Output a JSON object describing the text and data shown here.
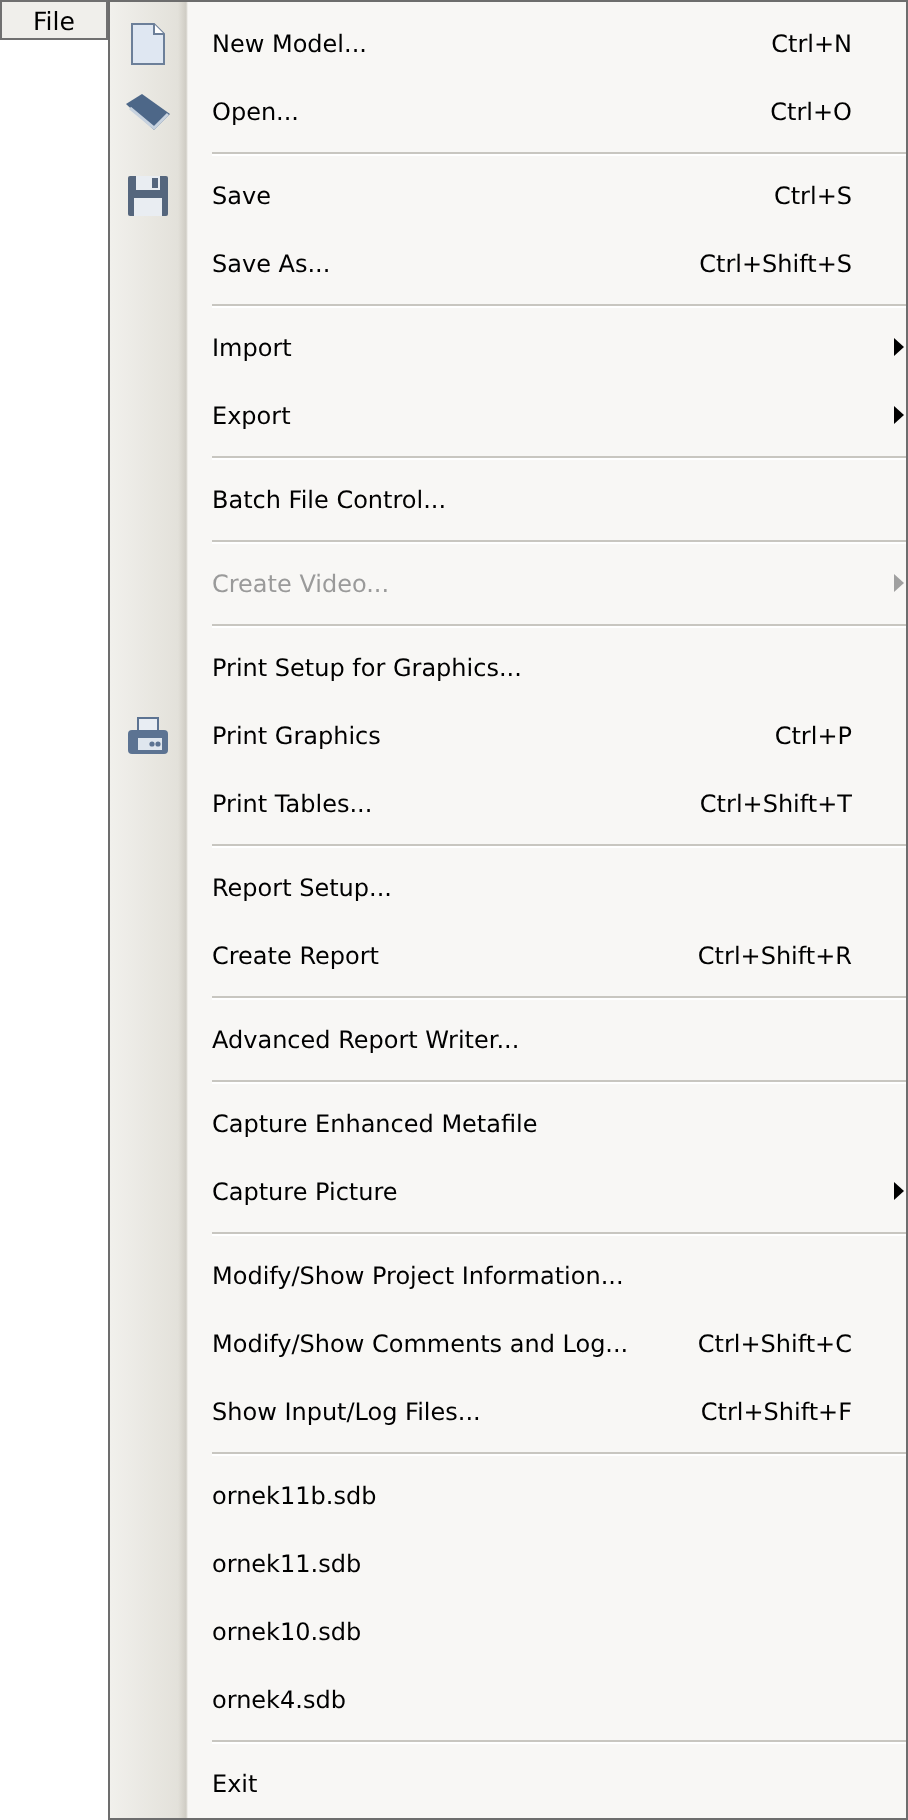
{
  "file_button": {
    "label": "File"
  },
  "menu": {
    "items": [
      {
        "kind": "item",
        "label": "New Model...",
        "shortcut": "Ctrl+N",
        "submenu": false,
        "disabled": false
      },
      {
        "kind": "item",
        "label": "Open...",
        "shortcut": "Ctrl+O",
        "submenu": false,
        "disabled": false
      },
      {
        "kind": "separator"
      },
      {
        "kind": "item",
        "label": "Save",
        "shortcut": "Ctrl+S",
        "submenu": false,
        "disabled": false
      },
      {
        "kind": "item",
        "label": "Save As...",
        "shortcut": "Ctrl+Shift+S",
        "submenu": false,
        "disabled": false
      },
      {
        "kind": "separator"
      },
      {
        "kind": "item",
        "label": "Import",
        "submenu": true,
        "disabled": false
      },
      {
        "kind": "item",
        "label": "Export",
        "submenu": true,
        "disabled": false
      },
      {
        "kind": "separator"
      },
      {
        "kind": "item",
        "label": "Batch File Control...",
        "submenu": false,
        "disabled": false
      },
      {
        "kind": "separator"
      },
      {
        "kind": "item",
        "label": "Create Video...",
        "submenu": true,
        "disabled": true
      },
      {
        "kind": "separator"
      },
      {
        "kind": "item",
        "label": "Print Setup for Graphics...",
        "submenu": false,
        "disabled": false
      },
      {
        "kind": "item",
        "label": "Print Graphics",
        "shortcut": "Ctrl+P",
        "submenu": false,
        "disabled": false
      },
      {
        "kind": "item",
        "label": "Print Tables...",
        "shortcut": "Ctrl+Shift+T",
        "submenu": false,
        "disabled": false
      },
      {
        "kind": "separator"
      },
      {
        "kind": "item",
        "label": "Report Setup...",
        "submenu": false,
        "disabled": false
      },
      {
        "kind": "item",
        "label": "Create Report",
        "shortcut": "Ctrl+Shift+R",
        "submenu": false,
        "disabled": false
      },
      {
        "kind": "separator"
      },
      {
        "kind": "item",
        "label": "Advanced Report Writer...",
        "submenu": false,
        "disabled": false
      },
      {
        "kind": "separator"
      },
      {
        "kind": "item",
        "label": "Capture Enhanced Metafile",
        "submenu": false,
        "disabled": false
      },
      {
        "kind": "item",
        "label": "Capture Picture",
        "submenu": true,
        "disabled": false
      },
      {
        "kind": "separator"
      },
      {
        "kind": "item",
        "label": "Modify/Show Project Information...",
        "submenu": false,
        "disabled": false
      },
      {
        "kind": "item",
        "label": "Modify/Show Comments and Log...",
        "shortcut": "Ctrl+Shift+C",
        "submenu": false,
        "disabled": false
      },
      {
        "kind": "item",
        "label": "Show Input/Log Files...",
        "shortcut": "Ctrl+Shift+F",
        "submenu": false,
        "disabled": false
      },
      {
        "kind": "separator"
      },
      {
        "kind": "item",
        "label": "ornek11b.sdb",
        "submenu": false,
        "disabled": false
      },
      {
        "kind": "item",
        "label": "ornek11.sdb",
        "submenu": false,
        "disabled": false
      },
      {
        "kind": "item",
        "label": "ornek10.sdb",
        "submenu": false,
        "disabled": false
      },
      {
        "kind": "item",
        "label": "ornek4.sdb",
        "submenu": false,
        "disabled": false
      },
      {
        "kind": "separator"
      },
      {
        "kind": "item",
        "label": "Exit",
        "submenu": false,
        "disabled": false
      }
    ]
  }
}
